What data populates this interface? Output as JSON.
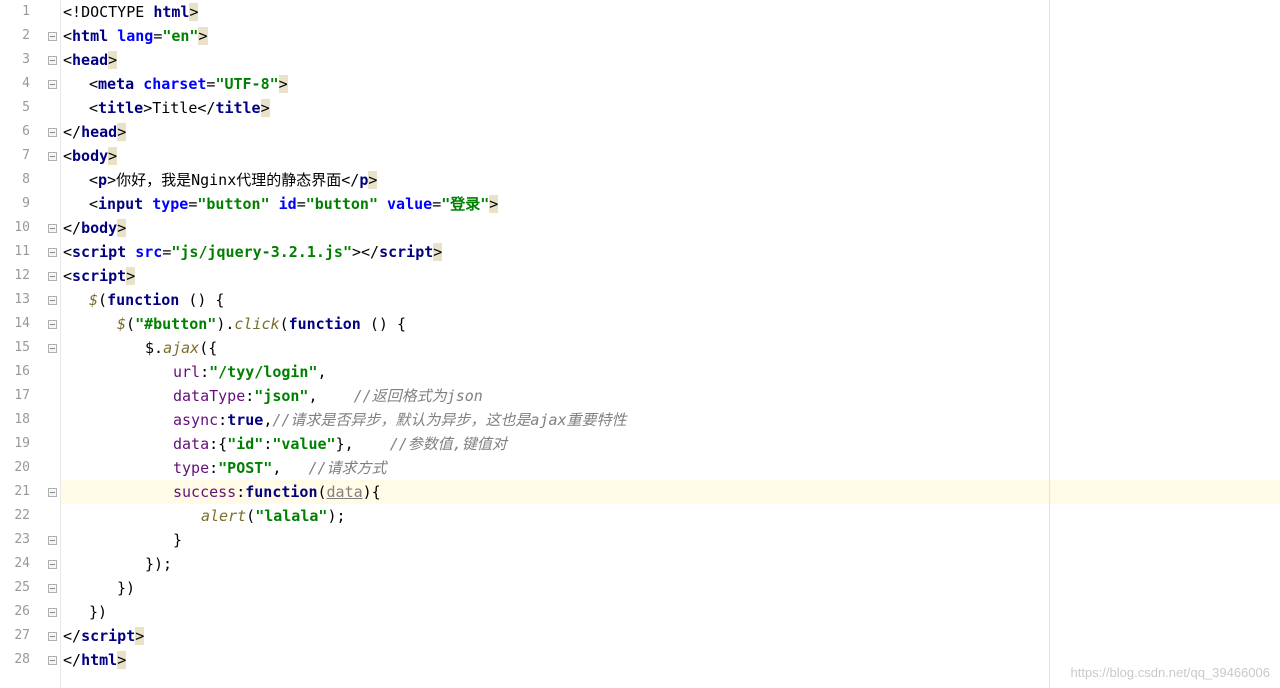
{
  "watermark": "https://blog.csdn.net/qq_39466006",
  "editor": {
    "lineCount": 28,
    "highlightedLine": 21,
    "foldMarks": [
      2,
      3,
      4,
      6,
      7,
      10,
      11,
      12,
      13,
      14,
      15,
      21,
      23,
      24,
      25,
      26,
      27,
      28
    ],
    "lines": [
      {
        "n": 1,
        "indent": 0,
        "tokens": [
          {
            "t": "<!",
            "c": "c-plain"
          },
          {
            "t": "DOCTYPE ",
            "c": "c-plain"
          },
          {
            "t": "html",
            "c": "c-kw"
          },
          {
            "t": ">",
            "c": "c-plain c-bracket"
          }
        ]
      },
      {
        "n": 2,
        "indent": 0,
        "tokens": [
          {
            "t": "<",
            "c": "c-plain"
          },
          {
            "t": "html ",
            "c": "c-kw"
          },
          {
            "t": "lang",
            "c": "c-attr"
          },
          {
            "t": "=",
            "c": "c-plain"
          },
          {
            "t": "\"en\"",
            "c": "c-str"
          },
          {
            "t": ">",
            "c": "c-plain c-bracket"
          }
        ]
      },
      {
        "n": 3,
        "indent": 0,
        "tokens": [
          {
            "t": "<",
            "c": "c-plain"
          },
          {
            "t": "head",
            "c": "c-kw"
          },
          {
            "t": ">",
            "c": "c-plain c-bracket"
          }
        ]
      },
      {
        "n": 4,
        "indent": 1,
        "tokens": [
          {
            "t": "<",
            "c": "c-plain"
          },
          {
            "t": "meta ",
            "c": "c-kw"
          },
          {
            "t": "charset",
            "c": "c-attr"
          },
          {
            "t": "=",
            "c": "c-plain"
          },
          {
            "t": "\"UTF-8\"",
            "c": "c-str"
          },
          {
            "t": ">",
            "c": "c-plain c-bracket"
          }
        ]
      },
      {
        "n": 5,
        "indent": 1,
        "tokens": [
          {
            "t": "<",
            "c": "c-plain"
          },
          {
            "t": "title",
            "c": "c-kw"
          },
          {
            "t": ">",
            "c": "c-plain"
          },
          {
            "t": "Title",
            "c": "c-title"
          },
          {
            "t": "</",
            "c": "c-plain"
          },
          {
            "t": "title",
            "c": "c-kw"
          },
          {
            "t": ">",
            "c": "c-plain c-bracket"
          }
        ]
      },
      {
        "n": 6,
        "indent": 0,
        "tokens": [
          {
            "t": "</",
            "c": "c-plain"
          },
          {
            "t": "head",
            "c": "c-kw"
          },
          {
            "t": ">",
            "c": "c-plain c-bracket"
          }
        ]
      },
      {
        "n": 7,
        "indent": 0,
        "tokens": [
          {
            "t": "<",
            "c": "c-plain"
          },
          {
            "t": "body",
            "c": "c-kw"
          },
          {
            "t": ">",
            "c": "c-plain c-bracket"
          }
        ]
      },
      {
        "n": 8,
        "indent": 1,
        "tokens": [
          {
            "t": "<",
            "c": "c-plain"
          },
          {
            "t": "p",
            "c": "c-kw"
          },
          {
            "t": ">",
            "c": "c-plain"
          },
          {
            "t": "你好，我是Nginx代理的静态界面",
            "c": "c-plain"
          },
          {
            "t": "</",
            "c": "c-plain"
          },
          {
            "t": "p",
            "c": "c-kw"
          },
          {
            "t": ">",
            "c": "c-plain c-bracket"
          }
        ]
      },
      {
        "n": 9,
        "indent": 1,
        "tokens": [
          {
            "t": "<",
            "c": "c-plain"
          },
          {
            "t": "input ",
            "c": "c-kw"
          },
          {
            "t": "type",
            "c": "c-attr"
          },
          {
            "t": "=",
            "c": "c-plain"
          },
          {
            "t": "\"button\" ",
            "c": "c-str"
          },
          {
            "t": "id",
            "c": "c-attr"
          },
          {
            "t": "=",
            "c": "c-plain"
          },
          {
            "t": "\"button\" ",
            "c": "c-str"
          },
          {
            "t": "value",
            "c": "c-attr"
          },
          {
            "t": "=",
            "c": "c-plain"
          },
          {
            "t": "\"登录\"",
            "c": "c-str"
          },
          {
            "t": ">",
            "c": "c-plain c-bracket"
          }
        ]
      },
      {
        "n": 10,
        "indent": 0,
        "tokens": [
          {
            "t": "</",
            "c": "c-plain"
          },
          {
            "t": "body",
            "c": "c-kw"
          },
          {
            "t": ">",
            "c": "c-plain c-bracket"
          }
        ]
      },
      {
        "n": 11,
        "indent": 0,
        "tokens": [
          {
            "t": "<",
            "c": "c-plain"
          },
          {
            "t": "script ",
            "c": "c-kw"
          },
          {
            "t": "src",
            "c": "c-attr"
          },
          {
            "t": "=",
            "c": "c-plain"
          },
          {
            "t": "\"js/jquery-3.2.1.js\"",
            "c": "c-str"
          },
          {
            "t": ">",
            "c": "c-plain"
          },
          {
            "t": "</",
            "c": "c-plain"
          },
          {
            "t": "script",
            "c": "c-kw"
          },
          {
            "t": ">",
            "c": "c-plain c-bracket"
          }
        ]
      },
      {
        "n": 12,
        "indent": 0,
        "tokens": [
          {
            "t": "<",
            "c": "c-plain"
          },
          {
            "t": "script",
            "c": "c-kw"
          },
          {
            "t": ">",
            "c": "c-plain c-bracket"
          }
        ]
      },
      {
        "n": 13,
        "indent": 1,
        "tokens": [
          {
            "t": "$",
            "c": "c-fn"
          },
          {
            "t": "(",
            "c": "c-plain"
          },
          {
            "t": "function ",
            "c": "c-kw"
          },
          {
            "t": "() {",
            "c": "c-plain"
          }
        ]
      },
      {
        "n": 14,
        "indent": 2,
        "tokens": [
          {
            "t": "$",
            "c": "c-fn"
          },
          {
            "t": "(",
            "c": "c-plain"
          },
          {
            "t": "\"#button\"",
            "c": "c-str"
          },
          {
            "t": ").",
            "c": "c-plain"
          },
          {
            "t": "click",
            "c": "c-fn"
          },
          {
            "t": "(",
            "c": "c-plain"
          },
          {
            "t": "function ",
            "c": "c-kw"
          },
          {
            "t": "() {",
            "c": "c-plain"
          }
        ]
      },
      {
        "n": 15,
        "indent": 3,
        "tokens": [
          {
            "t": "$.",
            "c": "c-plain"
          },
          {
            "t": "ajax",
            "c": "c-fn"
          },
          {
            "t": "({",
            "c": "c-plain"
          }
        ]
      },
      {
        "n": 16,
        "indent": 4,
        "tokens": [
          {
            "t": "url",
            "c": "c-ident"
          },
          {
            "t": ":",
            "c": "c-plain"
          },
          {
            "t": "\"/tyy/login\"",
            "c": "c-str"
          },
          {
            "t": ",",
            "c": "c-plain"
          }
        ]
      },
      {
        "n": 17,
        "indent": 4,
        "tokens": [
          {
            "t": "dataType",
            "c": "c-ident"
          },
          {
            "t": ":",
            "c": "c-plain"
          },
          {
            "t": "\"json\"",
            "c": "c-str"
          },
          {
            "t": ",    ",
            "c": "c-plain"
          },
          {
            "t": "//返回格式为json",
            "c": "c-comment"
          }
        ]
      },
      {
        "n": 18,
        "indent": 4,
        "tokens": [
          {
            "t": "async",
            "c": "c-ident"
          },
          {
            "t": ":",
            "c": "c-plain"
          },
          {
            "t": "true",
            "c": "c-bool"
          },
          {
            "t": ",",
            "c": "c-plain"
          },
          {
            "t": "//请求是否异步，默认为异步，这也是ajax重要特性",
            "c": "c-comment"
          }
        ]
      },
      {
        "n": 19,
        "indent": 4,
        "tokens": [
          {
            "t": "data",
            "c": "c-ident"
          },
          {
            "t": ":{",
            "c": "c-plain"
          },
          {
            "t": "\"id\"",
            "c": "c-str"
          },
          {
            "t": ":",
            "c": "c-plain"
          },
          {
            "t": "\"value\"",
            "c": "c-str"
          },
          {
            "t": "},    ",
            "c": "c-plain"
          },
          {
            "t": "//参数值,键值对",
            "c": "c-comment"
          }
        ]
      },
      {
        "n": 20,
        "indent": 4,
        "tokens": [
          {
            "t": "type",
            "c": "c-ident"
          },
          {
            "t": ":",
            "c": "c-plain"
          },
          {
            "t": "\"POST\"",
            "c": "c-str"
          },
          {
            "t": ",   ",
            "c": "c-plain"
          },
          {
            "t": "//请求方式",
            "c": "c-comment"
          }
        ]
      },
      {
        "n": 21,
        "indent": 4,
        "tokens": [
          {
            "t": "success",
            "c": "c-ident"
          },
          {
            "t": ":",
            "c": "c-plain"
          },
          {
            "t": "function",
            "c": "c-kw"
          },
          {
            "t": "(",
            "c": "c-plain"
          },
          {
            "t": "data",
            "c": "c-under"
          },
          {
            "t": "){",
            "c": "c-plain"
          }
        ]
      },
      {
        "n": 22,
        "indent": 5,
        "tokens": [
          {
            "t": "alert",
            "c": "c-fn"
          },
          {
            "t": "(",
            "c": "c-plain"
          },
          {
            "t": "\"lalala\"",
            "c": "c-str"
          },
          {
            "t": ");",
            "c": "c-plain"
          }
        ]
      },
      {
        "n": 23,
        "indent": 4,
        "tokens": [
          {
            "t": "}",
            "c": "c-plain"
          }
        ]
      },
      {
        "n": 24,
        "indent": 3,
        "tokens": [
          {
            "t": "});",
            "c": "c-plain"
          }
        ]
      },
      {
        "n": 25,
        "indent": 2,
        "tokens": [
          {
            "t": "})",
            "c": "c-plain"
          }
        ]
      },
      {
        "n": 26,
        "indent": 1,
        "tokens": [
          {
            "t": "})",
            "c": "c-plain"
          }
        ]
      },
      {
        "n": 27,
        "indent": 0,
        "tokens": [
          {
            "t": "</",
            "c": "c-plain"
          },
          {
            "t": "script",
            "c": "c-kw"
          },
          {
            "t": ">",
            "c": "c-plain c-bracket"
          }
        ]
      },
      {
        "n": 28,
        "indent": 0,
        "tokens": [
          {
            "t": "</",
            "c": "c-plain"
          },
          {
            "t": "html",
            "c": "c-kw"
          },
          {
            "t": ">",
            "c": "c-plain c-bracket"
          }
        ]
      }
    ]
  }
}
